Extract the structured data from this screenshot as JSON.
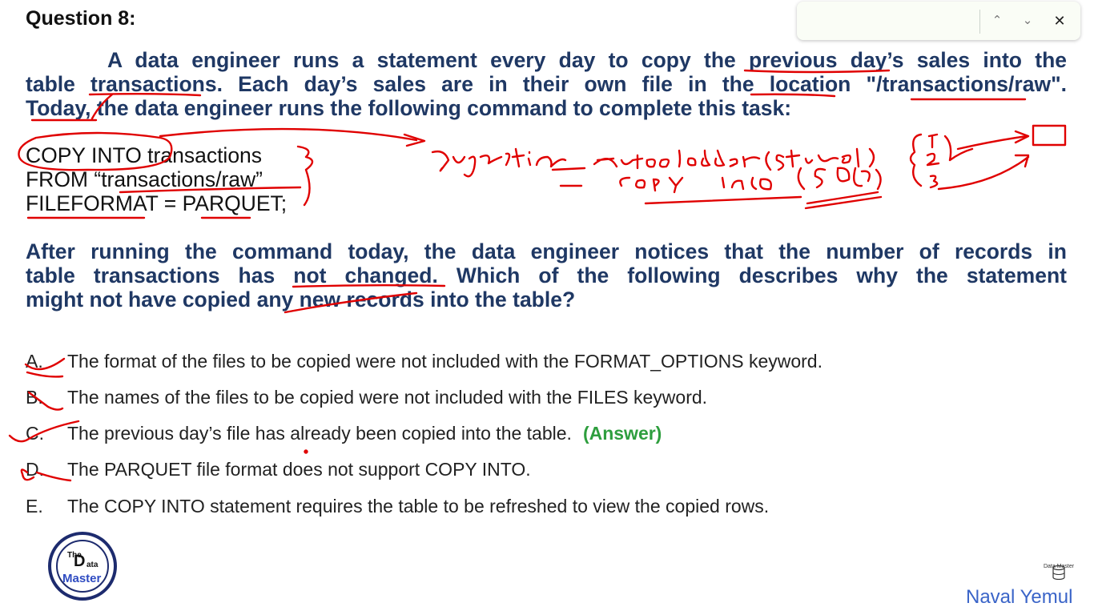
{
  "question": {
    "title": "Question 8:",
    "lines": [
      "A data engineer runs a statement every day to copy the previous day’s sales into the",
      "table transactions. Each day’s sales are in their own file in the location \"/transactions/raw\".",
      "Today, the data engineer runs the following command to complete this task:"
    ],
    "code": [
      "COPY INTO transactions",
      "FROM “transactions/raw”",
      "FILEFORMAT = PARQUET;"
    ],
    "followup": [
      "After running the command today, the data engineer notices that the number of records in",
      "table transactions has not changed. Which of the following describes why the statement",
      "might not have copied any new records into the table?"
    ]
  },
  "options": [
    {
      "letter": "A.",
      "text": "The format of the files to be copied were not included with the FORMAT_OPTIONS keyword.",
      "answer": ""
    },
    {
      "letter": "B.",
      "text": "The names of the files to be copied were not included with the FILES keyword.",
      "answer": ""
    },
    {
      "letter": "C.",
      "text": "The previous day’s file has already been copied into the table.",
      "answer": "(Answer)"
    },
    {
      "letter": "D.",
      "text": "The PARQUET file format does not support COPY INTO.",
      "answer": ""
    },
    {
      "letter": "E.",
      "text": "The COPY INTO statement requires the table to be refreshed to view the copied rows.",
      "answer": ""
    }
  ],
  "findbar": {
    "up_icon": "chevron-up-icon",
    "down_icon": "chevron-down-icon",
    "close_icon": "close-icon"
  },
  "branding": {
    "name": "Naval Yemul",
    "mini": "Data Master"
  },
  "colors": {
    "question_text": "#1f3864",
    "answer": "#2e9e3e",
    "ink": "#e00000",
    "brand": "#3a64c8"
  }
}
